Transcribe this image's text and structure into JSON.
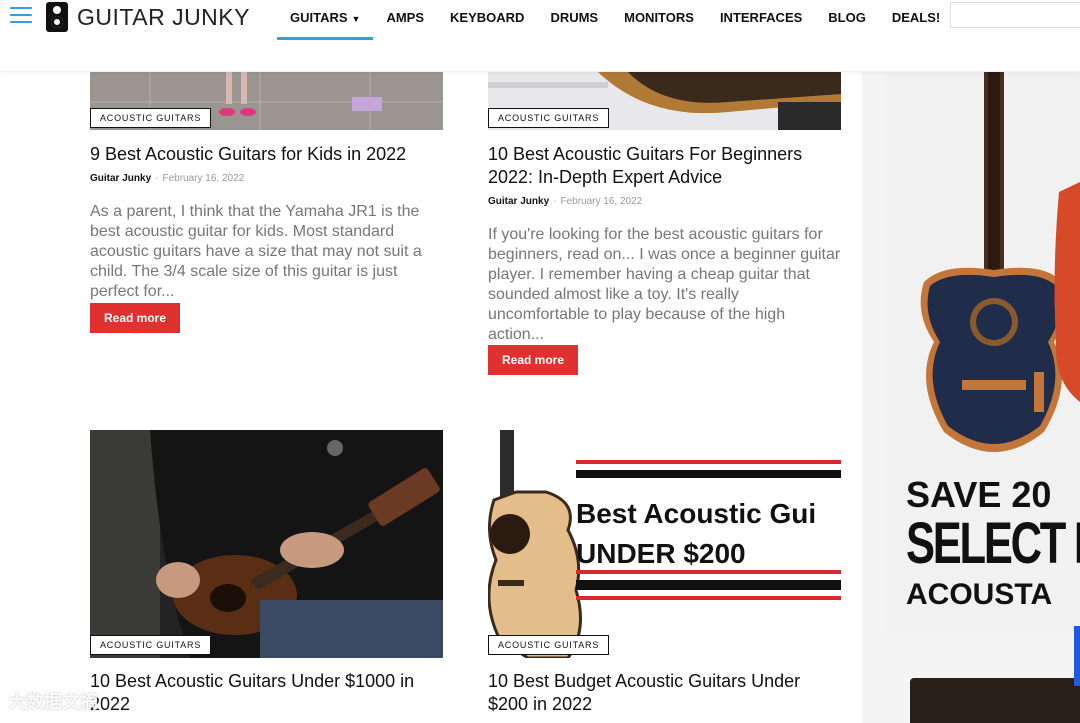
{
  "site": {
    "logo_text": "GUITAR JUNKY"
  },
  "nav": [
    {
      "label": "GUITARS"
    },
    {
      "label": "AMPS"
    },
    {
      "label": "KEYBOARD"
    },
    {
      "label": "DRUMS"
    },
    {
      "label": "MONITORS"
    },
    {
      "label": "INTERFACES"
    },
    {
      "label": "BLOG"
    },
    {
      "label": "DEALS!"
    }
  ],
  "articles": [
    {
      "category": "ACOUSTIC GUITARS",
      "title": "9 Best Acoustic Guitars for Kids in 2022",
      "author": "Guitar Junky",
      "date": "February 16, 2022",
      "excerpt": "As a parent, I think that the Yamaha JR1 is the best acoustic guitar for kids. Most standard acoustic guitars have a size that may not suit a child. The 3/4 scale size of this guitar is just perfect for...",
      "read_more": "Read more"
    },
    {
      "category": "ACOUSTIC GUITARS",
      "title": "10 Best Acoustic Guitars For Beginners 2022: In-Depth Expert Advice",
      "author": "Guitar Junky",
      "date": "February 16, 2022",
      "excerpt": "If you're looking for the best acoustic guitars for beginners, read on... I was once a beginner guitar player. I remember having a cheap guitar that sounded almost like a toy. It's really uncomfortable to play because of the high action...",
      "read_more": "Read more"
    },
    {
      "category": "ACOUSTIC GUITARS",
      "title": "10 Best Acoustic Guitars Under $1000 in 2022"
    },
    {
      "category": "ACOUSTIC GUITARS",
      "title": "10 Best Budget Acoustic Guitars Under $200 in 2022",
      "thumb_line1": "Best Acoustic Gui",
      "thumb_line2": "UNDER $200"
    }
  ],
  "ad": {
    "line1": "SAVE 20",
    "line2": "SELECT F",
    "line3": "ACOUSTA"
  },
  "watermark": "大数据文摘"
}
